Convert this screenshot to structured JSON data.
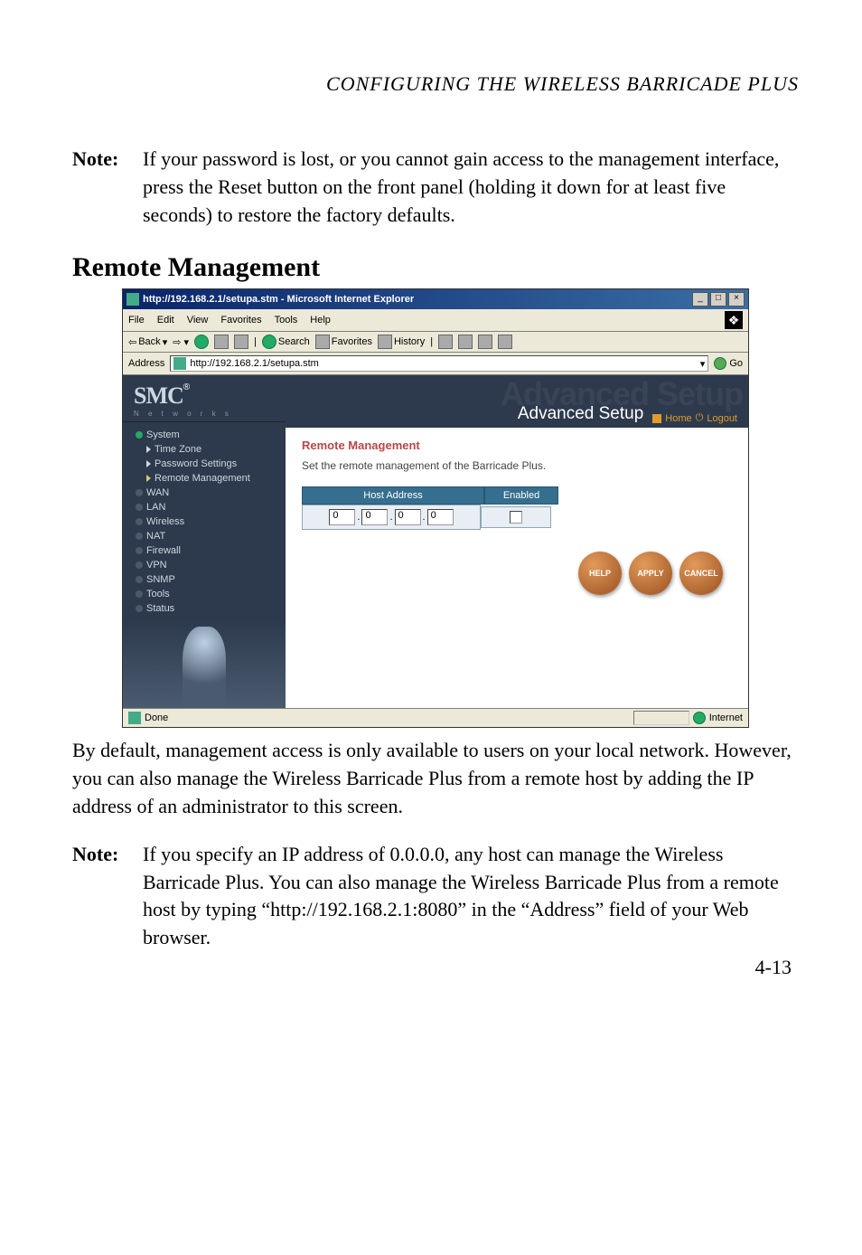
{
  "chapter": "CONFIGURING THE WIRELESS BARRICADE PLUS",
  "notes": {
    "note_label": "Note:",
    "note1": "If your password is lost, or you cannot gain access to the management interface, press the Reset button on the front panel (holding it down for at least five seconds) to restore the factory defaults.",
    "note2": "If you specify an IP address of 0.0.0.0, any host can manage the Wireless Barricade Plus. You can also manage the Wireless Barricade Plus from a remote host by typing “http://192.168.2.1:8080” in the “Address” field of your Web browser."
  },
  "section_heading": "Remote Management",
  "browser": {
    "title": "http://192.168.2.1/setupa.stm - Microsoft Internet Explorer",
    "menus": [
      "File",
      "Edit",
      "View",
      "Favorites",
      "Tools",
      "Help"
    ],
    "toolbar_back": "Back",
    "toolbar_search": "Search",
    "toolbar_favorites": "Favorites",
    "toolbar_history": "History",
    "address_label": "Address",
    "address_value": "http://192.168.2.1/setupa.stm",
    "go_label": "Go",
    "status_done": "Done",
    "status_zone": "Internet"
  },
  "smc": {
    "brand": "SMC",
    "reg": "®",
    "sub": "N e t w o r k s"
  },
  "nav": {
    "system": "System",
    "time_zone": "Time Zone",
    "password_settings": "Password Settings",
    "remote_management": "Remote Management",
    "wan": "WAN",
    "lan": "LAN",
    "wireless": "Wireless",
    "nat": "NAT",
    "firewall": "Firewall",
    "vpn": "VPN",
    "snmp": "SNMP",
    "tools": "Tools",
    "status": "Status"
  },
  "adv": {
    "ghost": "Advanced Setup",
    "title": "Advanced Setup",
    "home": "Home",
    "logout": "Logout"
  },
  "panel": {
    "title": "Remote Management",
    "desc": "Set the remote management of the Barricade Plus.",
    "col_host": "Host Address",
    "col_enabled": "Enabled",
    "ip": [
      "0",
      "0",
      "0",
      "0"
    ],
    "btn_help": "HELP",
    "btn_apply": "APPLY",
    "btn_cancel": "CANCEL"
  },
  "body_para": "By default, management access is only available to users on your local network. However, you can also manage the Wireless Barricade Plus from a remote host by adding the IP address of an administrator to this screen.",
  "pagenum": "4-13"
}
